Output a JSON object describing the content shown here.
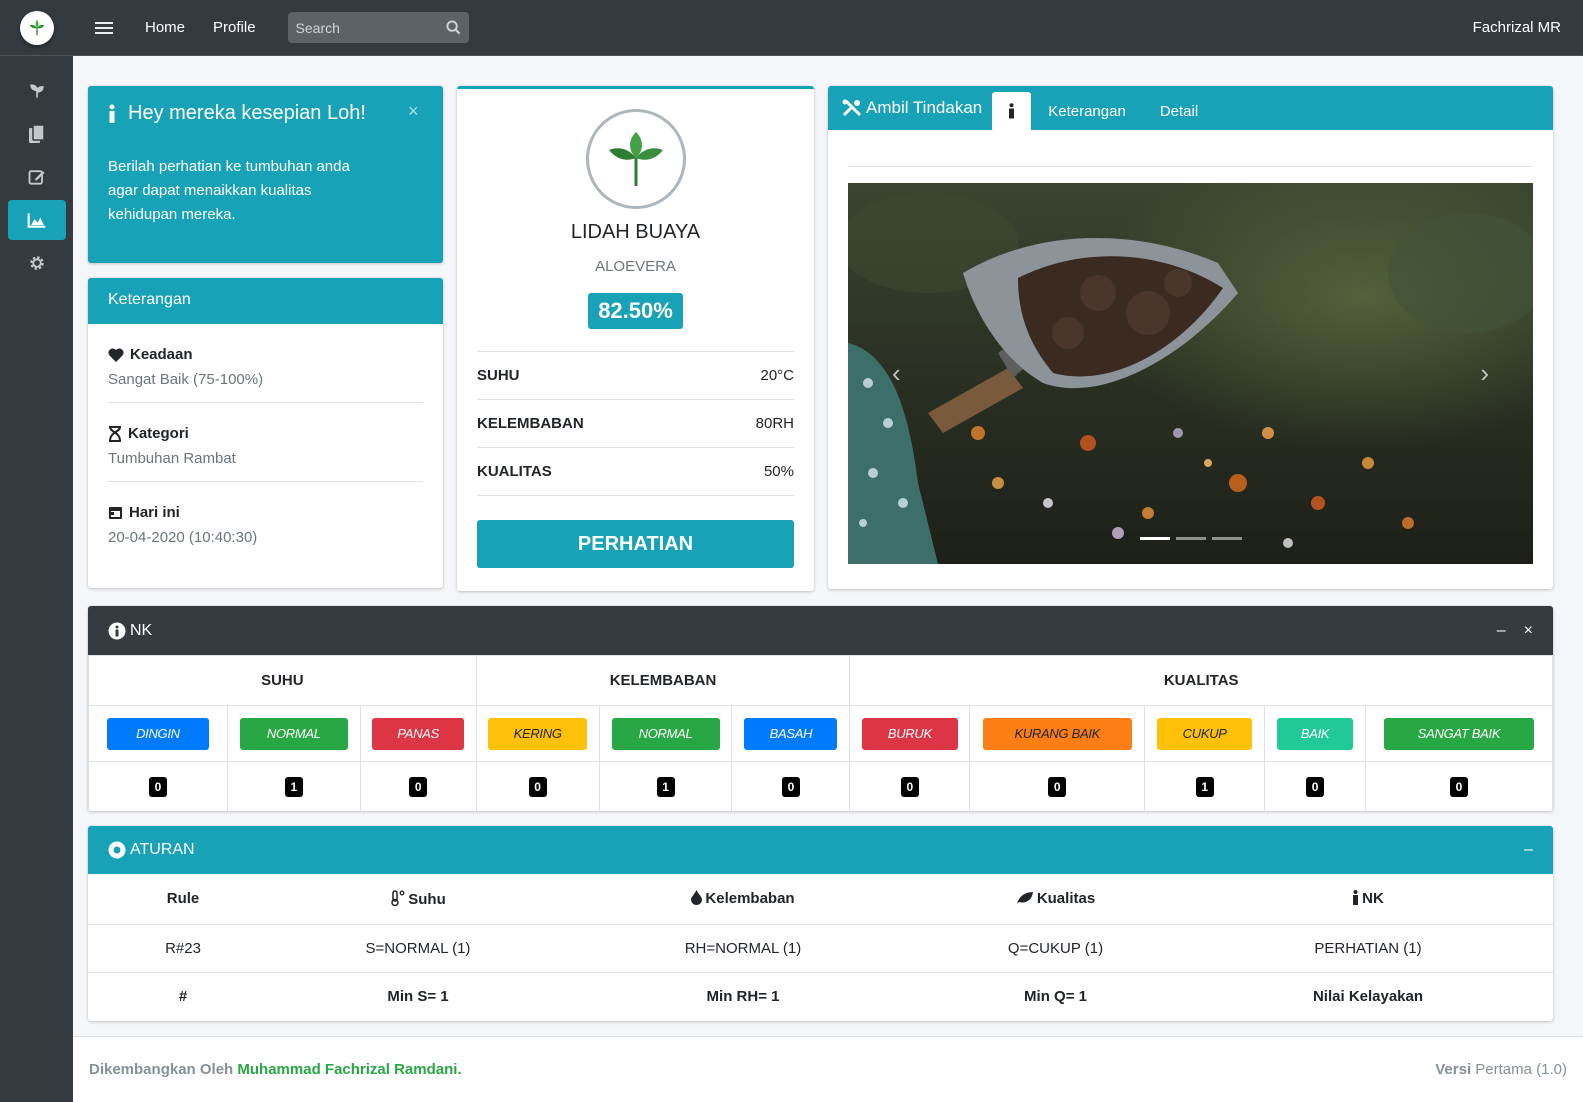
{
  "navbar": {
    "home": "Home",
    "profile": "Profile",
    "search_placeholder": "Search",
    "user": "Fachrizal MR"
  },
  "alert": {
    "title": "Hey mereka kesepian Loh!",
    "close": "×",
    "body": "Berilah perhatian ke tumbuhan anda agar dapat menaikkan kualitas kehidupan mereka."
  },
  "keterangan": {
    "title": "Keterangan",
    "items": [
      {
        "label": "Keadaan",
        "value": "Sangat Baik (75-100%)"
      },
      {
        "label": "Kategori",
        "value": "Tumbuhan Rambat"
      },
      {
        "label": "Hari ini",
        "value": "20-04-2020 (10:40:30)"
      }
    ]
  },
  "plant": {
    "name": "LIDAH BUAYA",
    "latin": "ALOEVERA",
    "percent": "82.50%",
    "stats": [
      {
        "label": "SUHU",
        "value": "20°C"
      },
      {
        "label": "KELEMBABAN",
        "value": "80RH"
      },
      {
        "label": "KUALITAS",
        "value": "50%"
      }
    ],
    "button": "PERHATIAN"
  },
  "tabs": {
    "title": "Ambil Tindakan",
    "active_icon": "i",
    "items": [
      "Keterangan",
      "Detail"
    ],
    "prev": "‹",
    "next": "›"
  },
  "nk": {
    "title": "NK",
    "minimize": "–",
    "close": "×",
    "groups": [
      "SUHU",
      "KELEMBABAN",
      "KUALITAS"
    ],
    "labels": [
      {
        "text": "DINGIN",
        "color": "#007bff",
        "count": "0"
      },
      {
        "text": "NORMAL",
        "color": "#28a745",
        "count": "1"
      },
      {
        "text": "PANAS",
        "color": "#dc3545",
        "count": "0"
      },
      {
        "text": "KERING",
        "color": "#ffc107",
        "count": "0"
      },
      {
        "text": "NORMAL",
        "color": "#28a745",
        "count": "1"
      },
      {
        "text": "BASAH",
        "color": "#007bff",
        "count": "0"
      },
      {
        "text": "BURUK",
        "color": "#dc3545",
        "count": "0"
      },
      {
        "text": "KURANG BAIK",
        "color": "#fd7e14",
        "count": "0"
      },
      {
        "text": "CUKUP",
        "color": "#ffc107",
        "count": "1"
      },
      {
        "text": "BAIK",
        "color": "#20c997",
        "count": "0"
      },
      {
        "text": "SANGAT BAIK",
        "color": "#28a745",
        "count": "0"
      }
    ]
  },
  "aturan": {
    "title": "ATURAN",
    "minimize": "–",
    "headers": [
      "Rule",
      "Suhu",
      "Kelembaban",
      "Kualitas",
      "NK"
    ],
    "row": [
      "R#23",
      "S=NORMAL (1)",
      "RH=NORMAL (1)",
      "Q=CUKUP (1)",
      "PERHATIAN (1)"
    ],
    "footer_row": [
      "#",
      "Min S= 1",
      "Min RH= 1",
      "Min Q= 1",
      "Nilai Kelayakan"
    ]
  },
  "footer": {
    "prefix": "Dikembangkan Oleh",
    "author": "Muhammad Fachrizal Ramdani.",
    "version_label": "Versi",
    "version": "Pertama (1.0)"
  },
  "colors": {
    "accent": "#17a2b8",
    "dark": "#343a40"
  }
}
